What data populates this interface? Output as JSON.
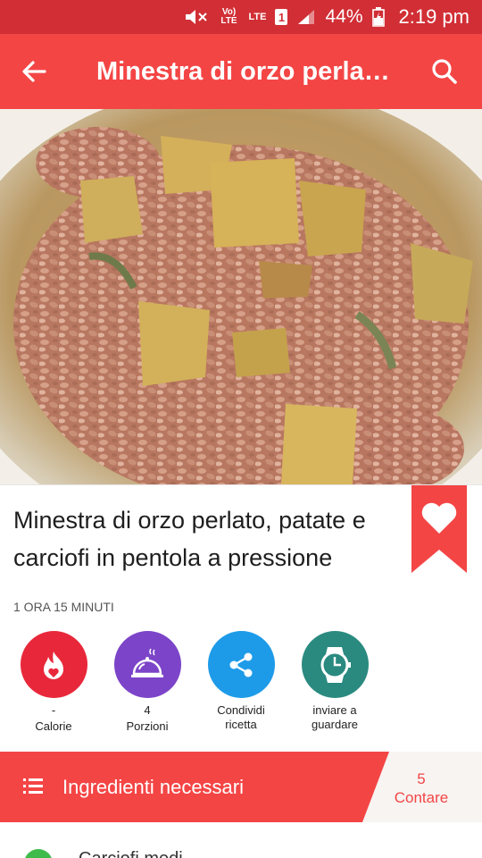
{
  "status_bar": {
    "battery": "44%",
    "time": "2:19 pm",
    "volte_label": "Vo) LTE",
    "lte_label": "LTE",
    "sim_label": "1"
  },
  "app_bar": {
    "title": "Minestra di orzo perlat…",
    "back_icon": "arrow-back-icon",
    "search_icon": "search-icon"
  },
  "recipe": {
    "title": "Minestra di orzo perlato, patate e carciofi in pentola a pressione",
    "duration": "1 ORA 15 MINUTI",
    "favorite_icon": "heart-icon"
  },
  "actions": [
    {
      "value": "-",
      "label": "Calorie",
      "icon": "flame-icon",
      "color": "#e8283a"
    },
    {
      "value": "4",
      "label": "Porzioni",
      "icon": "cloche-icon",
      "color": "#7c44c8"
    },
    {
      "value": "Condividi",
      "label": "ricetta",
      "icon": "share-icon",
      "color": "#1e9be8"
    },
    {
      "value": "inviare a",
      "label": "guardare",
      "icon": "watch-icon",
      "color": "#2a8a80"
    }
  ],
  "ingredients": {
    "label": "Ingredienti necessari",
    "count": "5",
    "count_label": "Contare",
    "first_item": "Carciofi medi"
  },
  "colors": {
    "accent": "#f44545",
    "status_bar": "#d12e35"
  }
}
